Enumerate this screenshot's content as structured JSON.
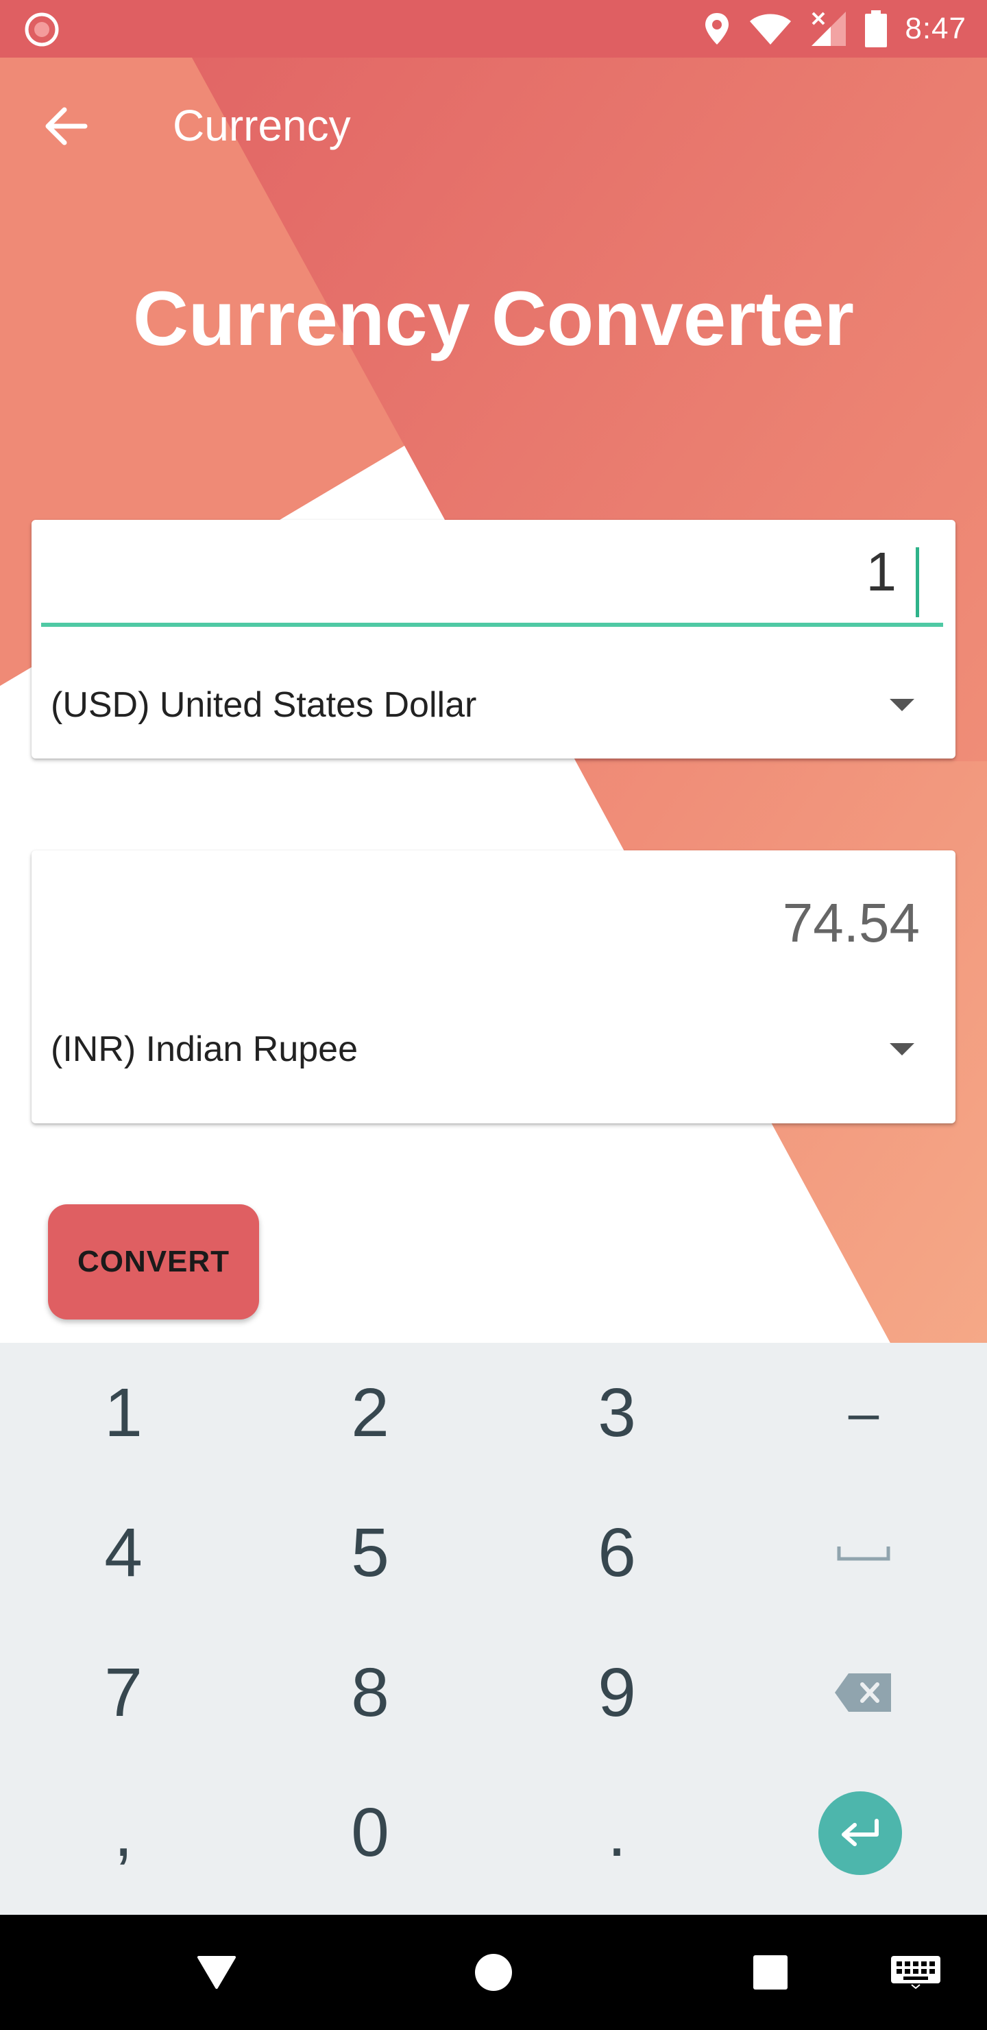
{
  "status_bar": {
    "time": "8:47",
    "icons": [
      "record-icon",
      "location-icon",
      "wifi-icon",
      "signal-icon",
      "battery-icon"
    ]
  },
  "app_bar": {
    "title": "Currency",
    "back_icon": "arrow-left-icon"
  },
  "hero": {
    "title": "Currency Converter"
  },
  "from_card": {
    "amount_value": "1",
    "currency_label": "(USD) United States Dollar"
  },
  "to_card": {
    "result_value": "74.54",
    "currency_label": "(INR) Indian Rupee"
  },
  "convert_button": {
    "label": "CONVERT"
  },
  "keyboard": {
    "rows": [
      [
        "1",
        "2",
        "3",
        "–"
      ],
      [
        "4",
        "5",
        "6",
        "space"
      ],
      [
        "7",
        "8",
        "9",
        "backspace"
      ],
      [
        ",",
        "0",
        ".",
        "enter"
      ]
    ]
  },
  "nav_bar": {
    "icons": [
      "back-triangle-icon",
      "home-circle-icon",
      "recents-square-icon",
      "keyboard-icon"
    ]
  },
  "colors": {
    "primary": "#df5f62",
    "accent": "#4fc9a4",
    "keyboard_bg": "#eceff1",
    "enter_key": "#4db6ac"
  }
}
